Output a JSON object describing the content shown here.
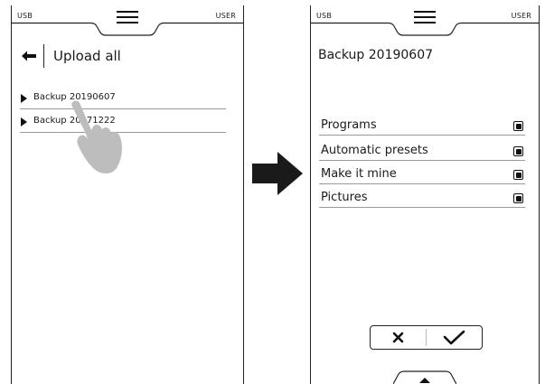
{
  "header": {
    "left_label": "USB",
    "right_label": "USER",
    "menu_icon": "hamburger-menu-icon"
  },
  "upload_screen": {
    "back_icon": "back-arrow-icon",
    "title": "Upload all",
    "items": [
      {
        "label": "Backup 20190607"
      },
      {
        "label": "Backup 20171222"
      }
    ],
    "gesture_icon": "tapping-hand-icon"
  },
  "transition": {
    "icon": "right-arrow-icon"
  },
  "backup_screen": {
    "title": "Backup 20190607",
    "options": [
      {
        "label": "Programs",
        "checked": true
      },
      {
        "label": "Automatic presets",
        "checked": true
      },
      {
        "label": "Make it mine",
        "checked": true
      },
      {
        "label": "Pictures",
        "checked": true
      }
    ],
    "actions": {
      "cancel_icon": "close-icon",
      "confirm_icon": "checkmark-icon"
    },
    "bottom_tab_icon": "chevron-up-icon"
  }
}
